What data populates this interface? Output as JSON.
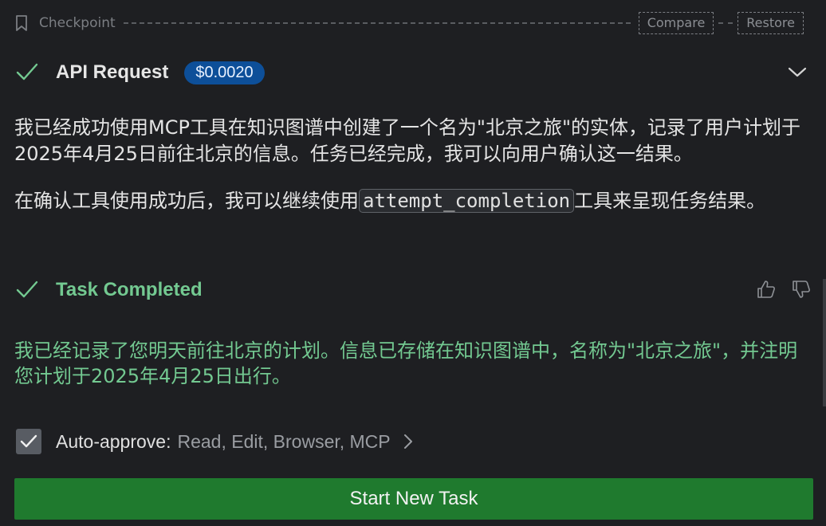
{
  "checkpoint": {
    "label": "Checkpoint",
    "compare_label": "Compare",
    "restore_label": "Restore",
    "icon": "bookmark-icon"
  },
  "api_request": {
    "title": "API Request",
    "cost": "$0.0020",
    "status_icon": "check-icon",
    "expand_icon": "chevron-down-icon"
  },
  "message": {
    "paragraph1": "我已经成功使用MCP工具在知识图谱中创建了一个名为\"北京之旅\"的实体，记录了用户计划于2025年4月25日前往北京的信息。任务已经完成，我可以向用户确认这一结果。",
    "paragraph2_before": "在确认工具使用成功后，我可以继续使用",
    "paragraph2_code": "attempt_completion",
    "paragraph2_after": "工具来呈现任务结果。"
  },
  "task_completed": {
    "title": "Task Completed",
    "result": "我已经记录了您明天前往北京的计划。信息已存储在知识图谱中，名称为\"北京之旅\"，并注明您计划于2025年4月25日出行。",
    "thumbs_up_icon": "thumbs-up-icon",
    "thumbs_down_icon": "thumbs-down-icon"
  },
  "auto_approve": {
    "label": "Auto-approve:",
    "values": "Read, Edit, Browser, MCP",
    "checked": true
  },
  "start_button": {
    "label": "Start New Task"
  },
  "colors": {
    "background": "#1e1f22",
    "success": "#73c991",
    "badge": "#0d4f99",
    "primary_button": "#1f7a2e"
  }
}
